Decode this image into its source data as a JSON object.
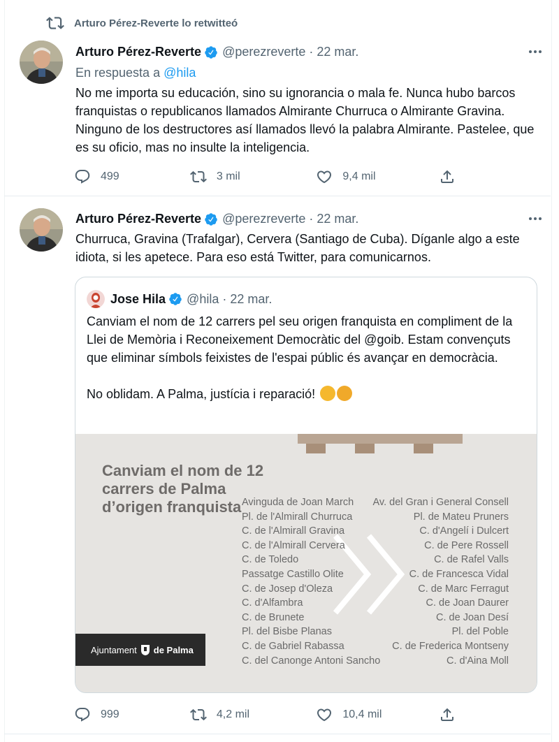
{
  "retweet_banner": "Arturo Pérez-Reverte lo retwitteó",
  "tweet1": {
    "name": "Arturo Pérez-Reverte",
    "handle": "@perezreverte",
    "date": "· 22 mar.",
    "reply_prefix": "En respuesta a",
    "reply_handle": "@hila",
    "text": "No me importa su educación, sino su ignorancia o mala fe. Nunca hubo barcos franquistas o republicanos llamados Almirante Churruca o Almirante Gravina. Ninguno de los destructores así llamados llevó la palabra Almirante. Pastelee, que es su oficio, mas no insulte la inteligencia.",
    "replies": "499",
    "retweets": "3 mil",
    "likes": "9,4 mil"
  },
  "tweet2": {
    "name": "Arturo Pérez-Reverte",
    "handle": "@perezreverte",
    "date": "· 22 mar.",
    "text": "Churruca, Gravina (Trafalgar), Cervera (Santiago de Cuba). Díganle algo a este idiota, si les apetece. Para eso está Twitter, para comunicarnos.",
    "replies": "999",
    "retweets": "4,2 mil",
    "likes": "10,4 mil"
  },
  "quoted": {
    "name": "Jose Hila",
    "handle": "@hila",
    "date": "· 22 mar.",
    "text": "Canviam el nom de 12 carrers pel seu origen franquista en compliment de la Llei de Memòria i Reconeixement Democràtic del @goib. Estam convençuts que eliminar símbols feixistes de l'espai públic és avançar en democràcia.",
    "text2": "No oblidam.  A Palma, justícia i reparació!",
    "image": {
      "title": "Canviam el nom de 12 carrers de Palma d’origen franquista",
      "left_list": [
        "Avinguda de Joan March",
        "Pl. de l'Almirall Churruca",
        "C. de l'Almirall Gravina",
        "C. de l'Almirall Cervera",
        "C. de Toledo",
        "Passatge Castillo Olite",
        "C. de Josep d'Oleza",
        "C. d'Alfambra",
        "C. de Brunete",
        "Pl. del Bisbe Planas",
        "C. de Gabriel Rabassa",
        "C. del Canonge Antoni Sancho"
      ],
      "right_list": [
        "Av. del Gran i General Consell",
        "Pl. de Mateu Pruners",
        "C. d'Angelí i Dulcert",
        "C. de Pere Rossell",
        "C. de Rafel Valls",
        "C. de Francesca Vidal",
        "C. de Marc Ferragut",
        "C. de Joan Daurer",
        "C. de Joan Desí",
        "Pl. del Poble",
        "C. de Frederica Montseny",
        "C. d'Aina Moll"
      ],
      "logo_prefix": "Ajuntament",
      "logo_suffix": "de Palma"
    }
  },
  "icons": {
    "retweet_banner": "retweet-icon",
    "verified": "verified-badge-icon",
    "more": "more-options-icon",
    "reply": "reply-icon",
    "retweet": "retweet-icon",
    "like": "heart-icon",
    "share": "share-icon",
    "emoji_1": "flexed-biceps-emoji",
    "emoji_2": "raised-fist-emoji"
  },
  "colors": {
    "accent": "#1d9bf0",
    "secondary_text": "#536471",
    "verified": "#1d9bf0"
  }
}
